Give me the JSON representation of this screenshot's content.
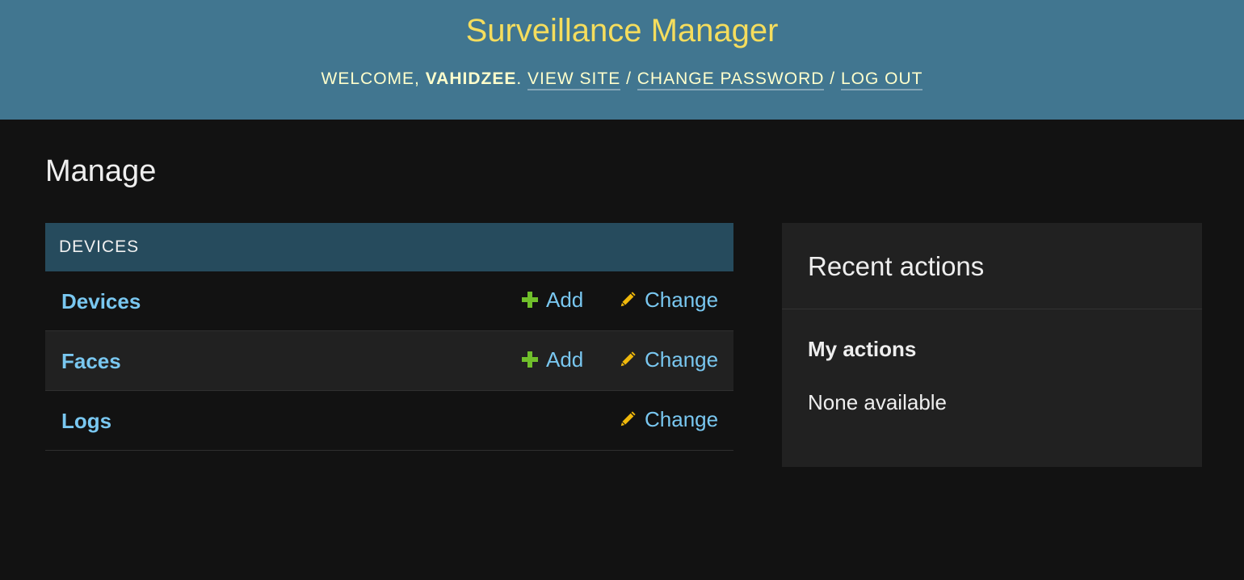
{
  "header": {
    "site_title": "Surveillance Manager",
    "welcome_prefix": "Welcome,",
    "username": "vahidzee",
    "links": {
      "view_site": "View site",
      "change_password": "Change password",
      "log_out": "Log out"
    },
    "separator": "/"
  },
  "page": {
    "title": "Manage"
  },
  "module": {
    "caption": "Devices",
    "rows": [
      {
        "name": "Devices",
        "add_label": "Add",
        "change_label": "Change"
      },
      {
        "name": "Faces",
        "add_label": "Add",
        "change_label": "Change"
      },
      {
        "name": "Logs",
        "change_label": "Change"
      }
    ]
  },
  "recent_actions": {
    "title": "Recent actions",
    "subtitle": "My actions",
    "empty_text": "None available"
  },
  "colors": {
    "header_bg": "#417690",
    "site_title": "#f5dd5d",
    "caption_bg": "#264b5d",
    "link": "#79c7f0",
    "add_icon": "#70bf2b",
    "change_icon": "#efb80b",
    "page_bg": "#121212"
  },
  "icons": {
    "add": "plus-icon",
    "change": "pencil-icon"
  }
}
